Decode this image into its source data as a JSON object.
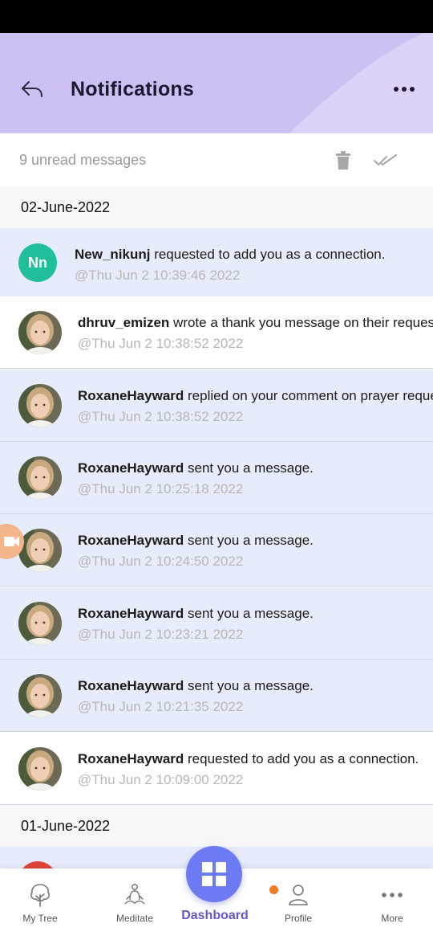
{
  "header": {
    "title": "Notifications",
    "back_icon": "back-arrow-icon",
    "more_icon": "more-vertical-dots-icon",
    "background_color": "#cfc0f3"
  },
  "toolbar": {
    "unread_text": "9 unread messages",
    "delete_icon": "trash-icon",
    "mark_read_icon": "double-check-icon"
  },
  "groups": [
    {
      "date": "02-June-2022",
      "items": [
        {
          "user": "New_nikunj",
          "text": " requested to add you as a connection.",
          "time": "@Thu Jun  2 10:39:46 2022",
          "unread": true,
          "avatar_initials": "Nn"
        },
        {
          "user": "dhruv_emizen",
          "text": " wrote a thank you message on their request",
          "time": "@Thu Jun  2 10:38:52 2022",
          "unread": false
        },
        {
          "user": "RoxaneHayward",
          "text": " replied on your comment on prayer request",
          "time": "@Thu Jun  2 10:38:52 2022",
          "unread": true
        },
        {
          "user": "RoxaneHayward",
          "text": " sent you a message.",
          "time": "@Thu Jun  2 10:25:18 2022",
          "unread": true
        },
        {
          "user": "RoxaneHayward",
          "text": " sent you a message.",
          "time": "@Thu Jun  2 10:24:50 2022",
          "unread": true
        },
        {
          "user": "RoxaneHayward",
          "text": " sent you a message.",
          "time": "@Thu Jun  2 10:23:21 2022",
          "unread": true
        },
        {
          "user": "RoxaneHayward",
          "text": " sent you a message.",
          "time": "@Thu Jun  2 10:21:35 2022",
          "unread": true
        },
        {
          "user": "RoxaneHayward",
          "text": " requested to add you as a connection.",
          "time": "@Thu Jun  2 10:09:00 2022",
          "unread": false
        }
      ]
    },
    {
      "date": "01-June-2022",
      "items": []
    }
  ],
  "nav": {
    "items": [
      {
        "label": "My Tree",
        "icon": "tree-icon"
      },
      {
        "label": "Meditate",
        "icon": "meditation-icon"
      },
      {
        "label": "Dashboard",
        "icon": "dashboard-grid-icon",
        "active": true
      },
      {
        "label": "Profile",
        "icon": "profile-icon",
        "badge": true
      },
      {
        "label": "More",
        "icon": "more-horizontal-dots-icon"
      }
    ]
  },
  "colors": {
    "unread_row": "#e7ecfb",
    "accent": "#6c7bf3",
    "initials_avatar": "#1fbf99",
    "badge": "#ef7a2a"
  }
}
